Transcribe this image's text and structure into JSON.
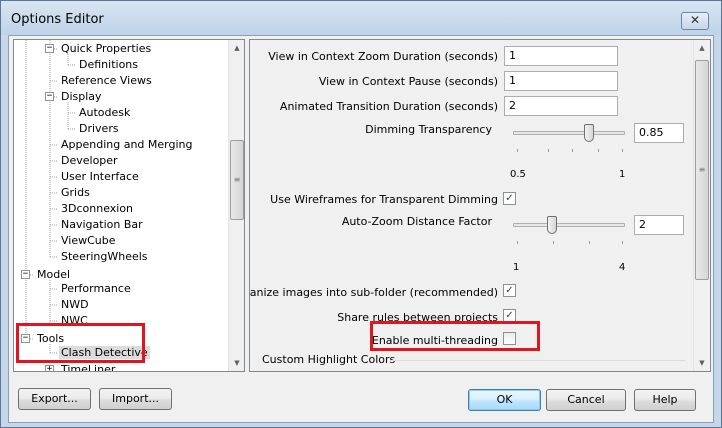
{
  "window": {
    "title": "Options Editor",
    "close_glyph": "✕"
  },
  "tree": {
    "nodes": [
      {
        "label": "Quick Properties",
        "expander": "−"
      },
      {
        "label": "Definitions",
        "expander": ""
      },
      {
        "label": "Reference Views",
        "expander": ""
      },
      {
        "label": "Display",
        "expander": "−"
      },
      {
        "label": "Autodesk",
        "expander": ""
      },
      {
        "label": "Drivers",
        "expander": ""
      },
      {
        "label": "Appending and Merging",
        "expander": ""
      },
      {
        "label": "Developer",
        "expander": ""
      },
      {
        "label": "User Interface",
        "expander": ""
      },
      {
        "label": "Grids",
        "expander": ""
      },
      {
        "label": "3Dconnexion",
        "expander": ""
      },
      {
        "label": "Navigation Bar",
        "expander": ""
      },
      {
        "label": "ViewCube",
        "expander": ""
      },
      {
        "label": "SteeringWheels",
        "expander": ""
      },
      {
        "label": "Model",
        "expander": "−"
      },
      {
        "label": "Performance",
        "expander": ""
      },
      {
        "label": "NWD",
        "expander": ""
      },
      {
        "label": "NWC",
        "expander": ""
      },
      {
        "label": "Tools",
        "expander": "−"
      },
      {
        "label": "Clash Detective",
        "expander": ""
      },
      {
        "label": "TimeLiner",
        "expander": "+"
      }
    ],
    "selected": "Clash Detective"
  },
  "settings": {
    "context_zoom_duration": {
      "label": "View in Context Zoom Duration (seconds)",
      "value": "1"
    },
    "context_pause": {
      "label": "View in Context Pause (seconds)",
      "value": "1"
    },
    "animated_transition": {
      "label": "Animated Transition Duration (seconds)",
      "value": "2"
    },
    "dimming_transparency": {
      "label": "Dimming Transparency",
      "value": "0.85",
      "min_label": "0.5",
      "max_label": "1",
      "level": 0.7
    },
    "use_wireframes": {
      "label": "Use Wireframes for Transparent Dimming",
      "checked": true
    },
    "auto_zoom": {
      "label": "Auto-Zoom Distance Factor",
      "value": "2",
      "min_label": "1",
      "max_label": "4",
      "level": 0.333
    },
    "organize_images": {
      "label": "Organize images into sub-folder (recommended)",
      "checked": true
    },
    "share_rules": {
      "label": "Share rules between projects",
      "checked": true
    },
    "multi_threading": {
      "label": "Enable multi-threading",
      "checked": false
    },
    "custom_highlight": {
      "label": "Custom Highlight Colors"
    }
  },
  "buttons": {
    "export": "Export...",
    "import": "Import...",
    "ok": "OK",
    "cancel": "Cancel",
    "help": "Help"
  },
  "glyphs": {
    "check": "✓",
    "arrow_up": "▲",
    "arrow_down": "▼",
    "grip": "≡"
  },
  "colors": {
    "highlight_box": "#e0151f",
    "selection": "#dcdcdc"
  }
}
